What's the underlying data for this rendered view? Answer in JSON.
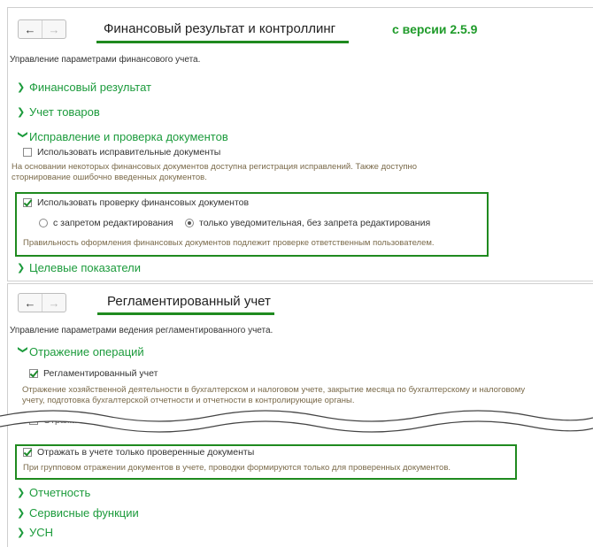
{
  "panel1": {
    "nav": {
      "back": "←",
      "forward": "→"
    },
    "title": "Финансовый результат и контроллинг",
    "version": "с версии 2.5.9",
    "description": "Управление параметрами финансового учета.",
    "sections": [
      {
        "label": "Финансовый результат"
      },
      {
        "label": "Учет товаров"
      },
      {
        "label": "Исправление и проверка документов"
      },
      {
        "label": "Целевые показатели"
      }
    ],
    "corrective_docs": {
      "label": "Использовать исправительные документы",
      "checked": false,
      "hint_line1": "На основании некоторых финансовых документов доступна регистрация исправлений. Также доступно",
      "hint_line2": "сторнирование ошибочно введенных документов."
    },
    "check_docs": {
      "label": "Использовать проверку финансовых документов",
      "checked": true,
      "radio_options": [
        {
          "label": "с запретом редактирования",
          "selected": false
        },
        {
          "label": "только уведомительная, без запрета редактирования",
          "selected": true
        }
      ],
      "hint": "Правильность оформления финансовых документов подлежит проверке ответственным пользователем."
    }
  },
  "panel2": {
    "nav": {
      "back": "←",
      "forward": "→"
    },
    "title": "Регламентированный учет",
    "description": "Управление параметрами ведения регламентированного учета.",
    "sections": [
      {
        "label": "Отражение операций"
      },
      {
        "label": "Отчетность"
      },
      {
        "label": "Сервисные функции"
      },
      {
        "label": "УСН"
      }
    ],
    "regulated": {
      "label": "Регламентированный учет",
      "checked": true,
      "hint_line1": "Отражение хозяйственной деятельности в бухгалтерском и налоговом учете, закрытие месяца по бухгалтерскому и налоговому",
      "hint_line2": "учету, подготовка бухгалтерской отчетности и отчетности в контролирующие органы."
    },
    "partial_label": "Отражать в учете",
    "verified_only": {
      "label": "Отражать в учете только проверенные документы",
      "checked": true,
      "hint": "При групповом отражении документов в учете, проводки формируются только для проверенных документов."
    }
  },
  "colors": {
    "accent": "#1c9b3c",
    "highlight": "#1f8a1f",
    "hint": "#7a6a4a"
  }
}
